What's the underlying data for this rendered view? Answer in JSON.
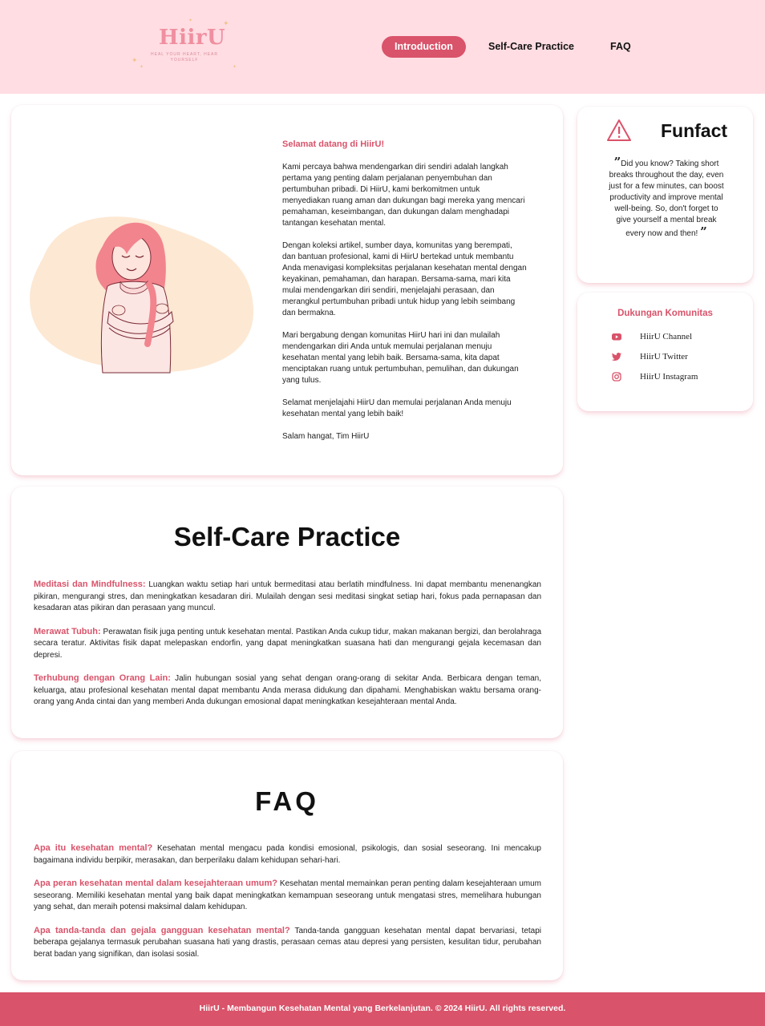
{
  "brand": {
    "name": "HiirU",
    "tagline": "HEAL YOUR HEART, HEAR YOURSELF",
    "color": "#ef8fa0"
  },
  "nav": {
    "items": [
      {
        "label": "Introduction",
        "active": true
      },
      {
        "label": "Self-Care Practice",
        "active": false
      },
      {
        "label": "FAQ",
        "active": false
      }
    ]
  },
  "intro": {
    "heading": "Selamat datang di HiirU!",
    "paragraphs": [
      "Kami percaya bahwa mendengarkan diri sendiri adalah langkah pertama yang penting dalam perjalanan penyembuhan dan pertumbuhan pribadi. Di HiirU, kami berkomitmen untuk menyediakan ruang aman dan dukungan bagi mereka yang mencari pemahaman, keseimbangan, dan dukungan dalam menghadapi tantangan kesehatan mental.",
      "Dengan koleksi artikel, sumber daya, komunitas yang berempati, dan bantuan profesional, kami di HiirU bertekad untuk membantu Anda menavigasi kompleksitas perjalanan kesehatan mental dengan keyakinan, pemahaman, dan harapan. Bersama-sama, mari kita mulai mendengarkan diri sendiri, menjelajahi perasaan, dan merangkul pertumbuhan pribadi untuk hidup yang lebih seimbang dan bermakna.",
      "Mari bergabung dengan komunitas HiirU hari ini dan mulailah mendengarkan diri Anda untuk memulai perjalanan menuju kesehatan mental yang lebih baik. Bersama-sama, kita dapat menciptakan ruang untuk pertumbuhan, pemulihan, dan dukungan yang tulus.",
      "Selamat menjelajahi HiirU dan memulai perjalanan Anda menuju kesehatan mental yang lebih baik!",
      "Salam hangat, Tim HiirU"
    ]
  },
  "funfact": {
    "title": "Funfact",
    "quote": "Did you know? Taking short breaks throughout the day, even just for a few minutes, can boost productivity and improve mental well-being. So, don't forget to give yourself a mental break every now and then!",
    "open_mark": "”",
    "close_mark": "”",
    "icon": "warning-triangle-icon"
  },
  "community": {
    "title": "Dukungan Komunitas",
    "links": [
      {
        "label": "HiirU Channel",
        "icon": "youtube-icon"
      },
      {
        "label": "HiirU Twitter",
        "icon": "twitter-icon"
      },
      {
        "label": "HiirU Instagram",
        "icon": "instagram-icon"
      }
    ]
  },
  "selfcare": {
    "title": "Self-Care Practice",
    "items": [
      {
        "term": "Meditasi dan Mindfulness:",
        "text": " Luangkan waktu setiap hari untuk bermeditasi atau berlatih mindfulness. Ini dapat membantu menenangkan pikiran, mengurangi stres, dan meningkatkan kesadaran diri. Mulailah dengan sesi meditasi singkat setiap hari, fokus pada pernapasan dan kesadaran atas pikiran dan perasaan yang muncul."
      },
      {
        "term": "Merawat Tubuh:",
        "text": " Perawatan fisik juga penting untuk kesehatan mental. Pastikan Anda cukup tidur, makan makanan bergizi, dan berolahraga secara teratur. Aktivitas fisik dapat melepaskan endorfin, yang dapat meningkatkan suasana hati dan mengurangi gejala kecemasan dan depresi."
      },
      {
        "term": "Terhubung dengan Orang Lain:",
        "text": " Jalin hubungan sosial yang sehat dengan orang-orang di sekitar Anda. Berbicara dengan teman, keluarga, atau profesional kesehatan mental dapat membantu Anda merasa didukung dan dipahami. Menghabiskan waktu bersama orang-orang yang Anda cintai dan yang memberi Anda dukungan emosional dapat meningkatkan kesejahteraan mental Anda."
      }
    ]
  },
  "faq": {
    "title": "FAQ",
    "items": [
      {
        "q": "Apa itu kesehatan mental?",
        "a": " Kesehatan mental mengacu pada kondisi emosional, psikologis, dan sosial seseorang. Ini mencakup bagaimana individu berpikir, merasakan, dan berperilaku dalam kehidupan sehari-hari."
      },
      {
        "q": "Apa peran kesehatan mental dalam kesejahteraan umum?",
        "a": " Kesehatan mental memainkan peran penting dalam kesejahteraan umum seseorang. Memiliki kesehatan mental yang baik dapat meningkatkan kemampuan seseorang untuk mengatasi stres, memelihara hubungan yang sehat, dan meraih potensi maksimal dalam kehidupan."
      },
      {
        "q": "Apa tanda-tanda dan gejala gangguan kesehatan mental?",
        "a": " Tanda-tanda gangguan kesehatan mental dapat bervariasi, tetapi beberapa gejalanya termasuk perubahan suasana hati yang drastis, perasaan cemas atau depresi yang persisten, kesulitan tidur, perubahan berat badan yang signifikan, dan isolasi sosial."
      }
    ]
  },
  "footer": {
    "text": "HiirU - Membangun Kesehatan Mental yang Berkelanjutan. © 2024 HiirU. All rights reserved."
  },
  "colors": {
    "header_bg": "#ffdde3",
    "accent": "#d9536a",
    "illustration_blob": "#fde8d3"
  }
}
